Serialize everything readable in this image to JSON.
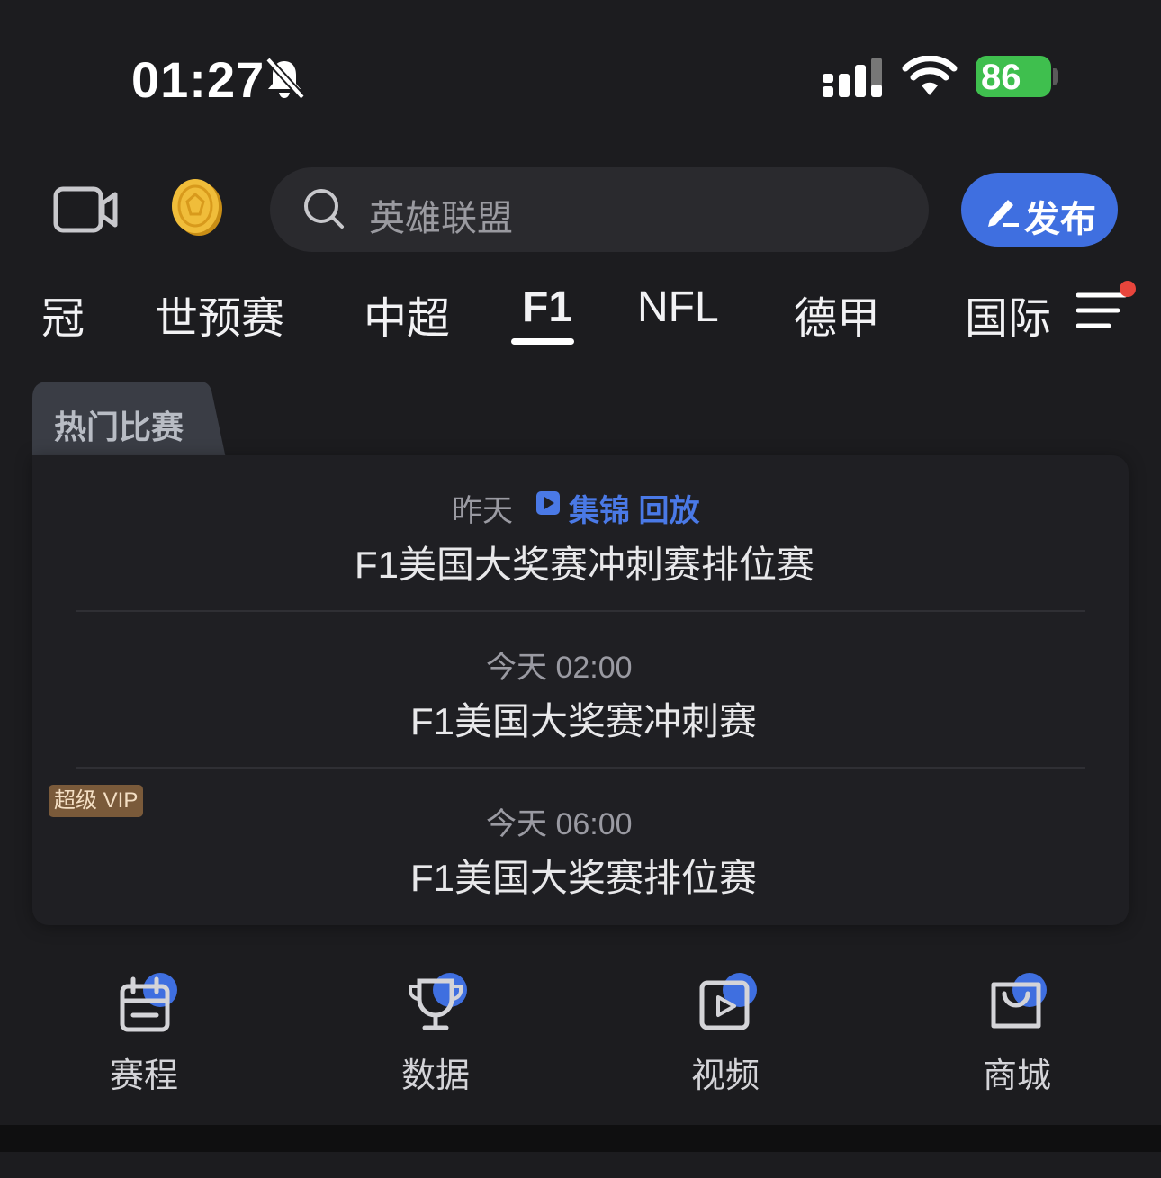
{
  "status_bar": {
    "time": "01:27",
    "battery": "86"
  },
  "top_bar": {
    "search_placeholder": "英雄联盟",
    "publish_label": "发布"
  },
  "tabs": [
    {
      "label": "冠",
      "active": false
    },
    {
      "label": "世预赛",
      "active": false
    },
    {
      "label": "中超",
      "active": false
    },
    {
      "label": "F1",
      "active": true
    },
    {
      "label": "NFL",
      "active": false
    },
    {
      "label": "德甲",
      "active": false
    },
    {
      "label": "国际",
      "active": false
    }
  ],
  "hot_matches": {
    "section_label": "热门比赛",
    "matches": [
      {
        "when": "昨天",
        "links": "集锦 回放",
        "title": "F1美国大奖赛冲刺赛排位赛"
      },
      {
        "when": "今天 02:00",
        "title": "F1美国大奖赛冲刺赛"
      },
      {
        "when": "今天 06:00",
        "title": "F1美国大奖赛排位赛",
        "badge": "超级 VIP"
      }
    ]
  },
  "shortcuts": [
    {
      "label": "赛程",
      "icon": "calendar-icon"
    },
    {
      "label": "数据",
      "icon": "trophy-icon"
    },
    {
      "label": "视频",
      "icon": "video-play-icon"
    },
    {
      "label": "商城",
      "icon": "shopping-bag-icon"
    }
  ],
  "colors": {
    "accent": "#3f6fe0",
    "link": "#4a79e6",
    "battery": "#3fbf4e",
    "notification_dot": "#e8453c",
    "vip_badge": "#7a5a3a"
  }
}
